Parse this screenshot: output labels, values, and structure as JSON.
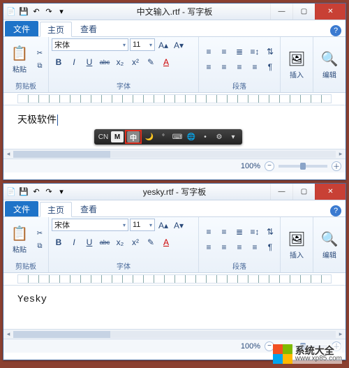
{
  "windows": [
    {
      "title": "中文输入.rtf - 写字板",
      "qat": {
        "doc_icon": "📄",
        "save": "💾",
        "undo": "↶",
        "redo": "↷"
      },
      "controls": {
        "min": "—",
        "max": "▢",
        "close": "✕"
      },
      "tabs": {
        "file": "文件",
        "home": "主页",
        "view": "查看",
        "help": "?"
      },
      "ribbon": {
        "clipboard": {
          "paste_label": "粘贴",
          "paste_icon": "📋",
          "cut_icon": "✂",
          "copy_icon": "⧉",
          "group_label": "剪贴板"
        },
        "font": {
          "family": "宋体",
          "size": "11",
          "grow": "A▴",
          "shrink": "A▾",
          "bold": "B",
          "italic": "I",
          "underline": "U",
          "strike": "abc",
          "sub": "x₂",
          "sup": "x²",
          "highlight": "✎",
          "color": "A",
          "group_label": "字体"
        },
        "paragraph": {
          "dec_indent": "≡",
          "inc_indent": "≡",
          "list": "≣",
          "spacing": "≡↕",
          "sort": "⇅",
          "align_l": "≡",
          "align_c": "≡",
          "align_r": "≡",
          "align_j": "≡",
          "para_dlg": "¶",
          "group_label": "段落"
        },
        "insert": {
          "label": "插入",
          "icon": "🖼"
        },
        "edit": {
          "label": "编辑",
          "icon": "🔍"
        }
      },
      "document_text": "天极软件",
      "ime": {
        "cn_label": "CN",
        "m_label": "M",
        "zhong": "中",
        "moon": "🌙",
        "ring": "°",
        "keyb": "⌨",
        "globe": "🌐",
        "dot": "•",
        "gear": "⚙",
        "dd": "▾"
      },
      "status": {
        "zoom": "100%",
        "minus": "−",
        "plus": "＋"
      }
    },
    {
      "title": "yesky.rtf - 写字板",
      "qat": {
        "doc_icon": "📄",
        "save": "💾",
        "undo": "↶",
        "redo": "↷"
      },
      "controls": {
        "min": "—",
        "max": "▢",
        "close": "✕"
      },
      "tabs": {
        "file": "文件",
        "home": "主页",
        "view": "查看",
        "help": "?"
      },
      "ribbon": {
        "clipboard": {
          "paste_label": "粘贴",
          "paste_icon": "📋",
          "cut_icon": "✂",
          "copy_icon": "⧉",
          "group_label": "剪贴板"
        },
        "font": {
          "family": "宋体",
          "size": "11",
          "grow": "A▴",
          "shrink": "A▾",
          "bold": "B",
          "italic": "I",
          "underline": "U",
          "strike": "abc",
          "sub": "x₂",
          "sup": "x²",
          "highlight": "✎",
          "color": "A",
          "group_label": "字体"
        },
        "paragraph": {
          "dec_indent": "≡",
          "inc_indent": "≡",
          "list": "≣",
          "spacing": "≡↕",
          "sort": "⇅",
          "align_l": "≡",
          "align_c": "≡",
          "align_r": "≡",
          "align_j": "≡",
          "para_dlg": "¶",
          "group_label": "段落"
        },
        "insert": {
          "label": "插入",
          "icon": "🖼"
        },
        "edit": {
          "label": "编辑",
          "icon": "🔍"
        }
      },
      "document_text": "Yesky",
      "status": {
        "zoom": "100%",
        "minus": "−",
        "plus": "＋"
      }
    }
  ],
  "watermark": {
    "line1": "系统大全",
    "line2": "www.xp85.com"
  }
}
